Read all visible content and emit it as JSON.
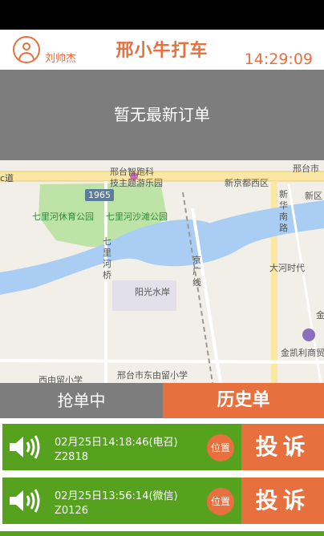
{
  "header": {
    "username": "刘帅杰",
    "app_title": "邢小牛打车",
    "clock": "14:29:09"
  },
  "new_order_banner": "暂无最新订单",
  "map": {
    "road_badge": "1965",
    "labels": {
      "edge_road": "c道",
      "hotel_top": "邢台市",
      "park_a": "邢台智跑科",
      "park_b": "技主题游乐园",
      "district": "新京都西区",
      "district_right": "新区",
      "road_vertical": "新华南路",
      "park_left": "七里河休育公园",
      "park_mid": "七里河沙滩公园",
      "bridge": "七里河桥",
      "rail": "京广线",
      "community": "大河时代",
      "estate": "阳光水岸",
      "school_left": "西由留小学",
      "school_mid": "邢台市东由留小学",
      "shop": "金凯利商贸",
      "jin": "金"
    }
  },
  "tabs": {
    "grab": "抢单中",
    "history": "历史单"
  },
  "orders": [
    {
      "timestamp": "02月25日14:18:46(电召)",
      "plate": "Z2818",
      "location_button": "位置",
      "complain_button": "投诉"
    },
    {
      "timestamp": "02月25日13:56:14(微信)",
      "plate": "Z0126",
      "location_button": "位置",
      "complain_button": "投诉"
    }
  ],
  "colors": {
    "accent": "#e8703f",
    "banner_gray": "#7d7d7d",
    "order_green": "#56a21e"
  }
}
